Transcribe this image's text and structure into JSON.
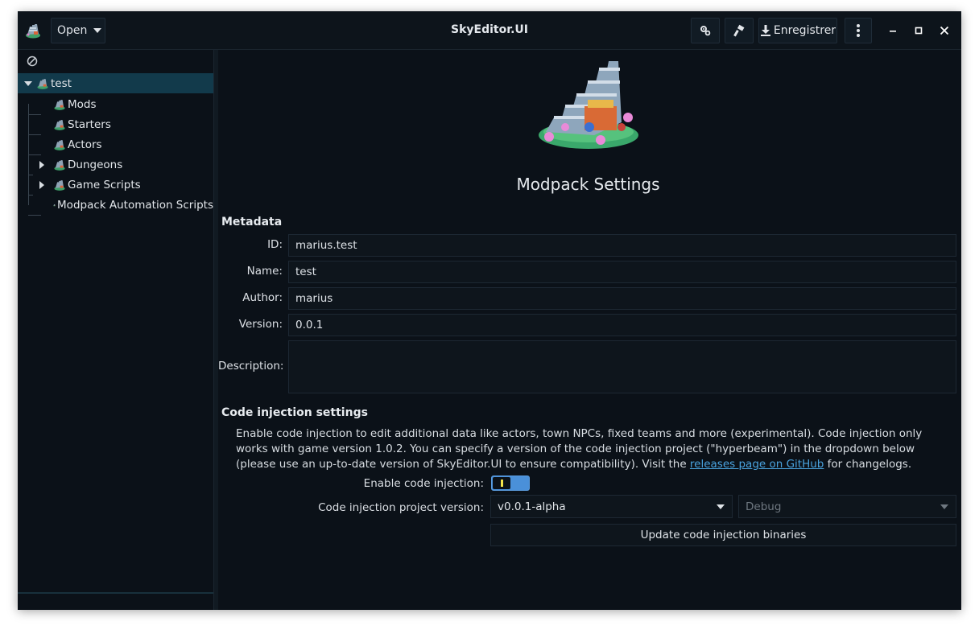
{
  "titlebar": {
    "open_label": "Open",
    "title": "SkyEditor.UI",
    "save_label": "Enregistrer"
  },
  "sidebar": {
    "root": {
      "label": "test",
      "expanded": true
    },
    "items": [
      {
        "label": "Mods",
        "expandable": false
      },
      {
        "label": "Starters",
        "expandable": false
      },
      {
        "label": "Actors",
        "expandable": false
      },
      {
        "label": "Dungeons",
        "expandable": true
      },
      {
        "label": "Game Scripts",
        "expandable": true
      },
      {
        "label": "Modpack Automation Scripts",
        "expandable": false
      }
    ]
  },
  "main": {
    "heading": "Modpack Settings",
    "metadata": {
      "title": "Metadata",
      "id_label": "ID:",
      "id_value": "marius.test",
      "name_label": "Name:",
      "name_value": "test",
      "author_label": "Author:",
      "author_value": "marius",
      "version_label": "Version:",
      "version_value": "0.0.1",
      "description_label": "Description:",
      "description_value": ""
    },
    "code_injection": {
      "title": "Code injection settings",
      "desc_before_link": "Enable code injection to edit additional data like actors, town NPCs, fixed teams and more (experimental). Code injection only works with game version 1.0.2. You can specify a version of the code injection project (\"hyperbeam\") in the dropdown below (please use an up-to-date version of SkyEditor.UI to ensure compatibility). Visit the ",
      "link_text": "releases page on GitHub",
      "desc_after_link": " for changelogs.",
      "enable_label": "Enable code injection:",
      "enabled": true,
      "version_label": "Code injection project version:",
      "version_value": "v0.0.1-alpha",
      "config_value": "Debug",
      "update_button": "Update code injection binaries"
    }
  },
  "colors": {
    "background": "#0b1118",
    "selection": "#123a4b",
    "accent": "#4a90d9",
    "link": "#4aa3df"
  }
}
